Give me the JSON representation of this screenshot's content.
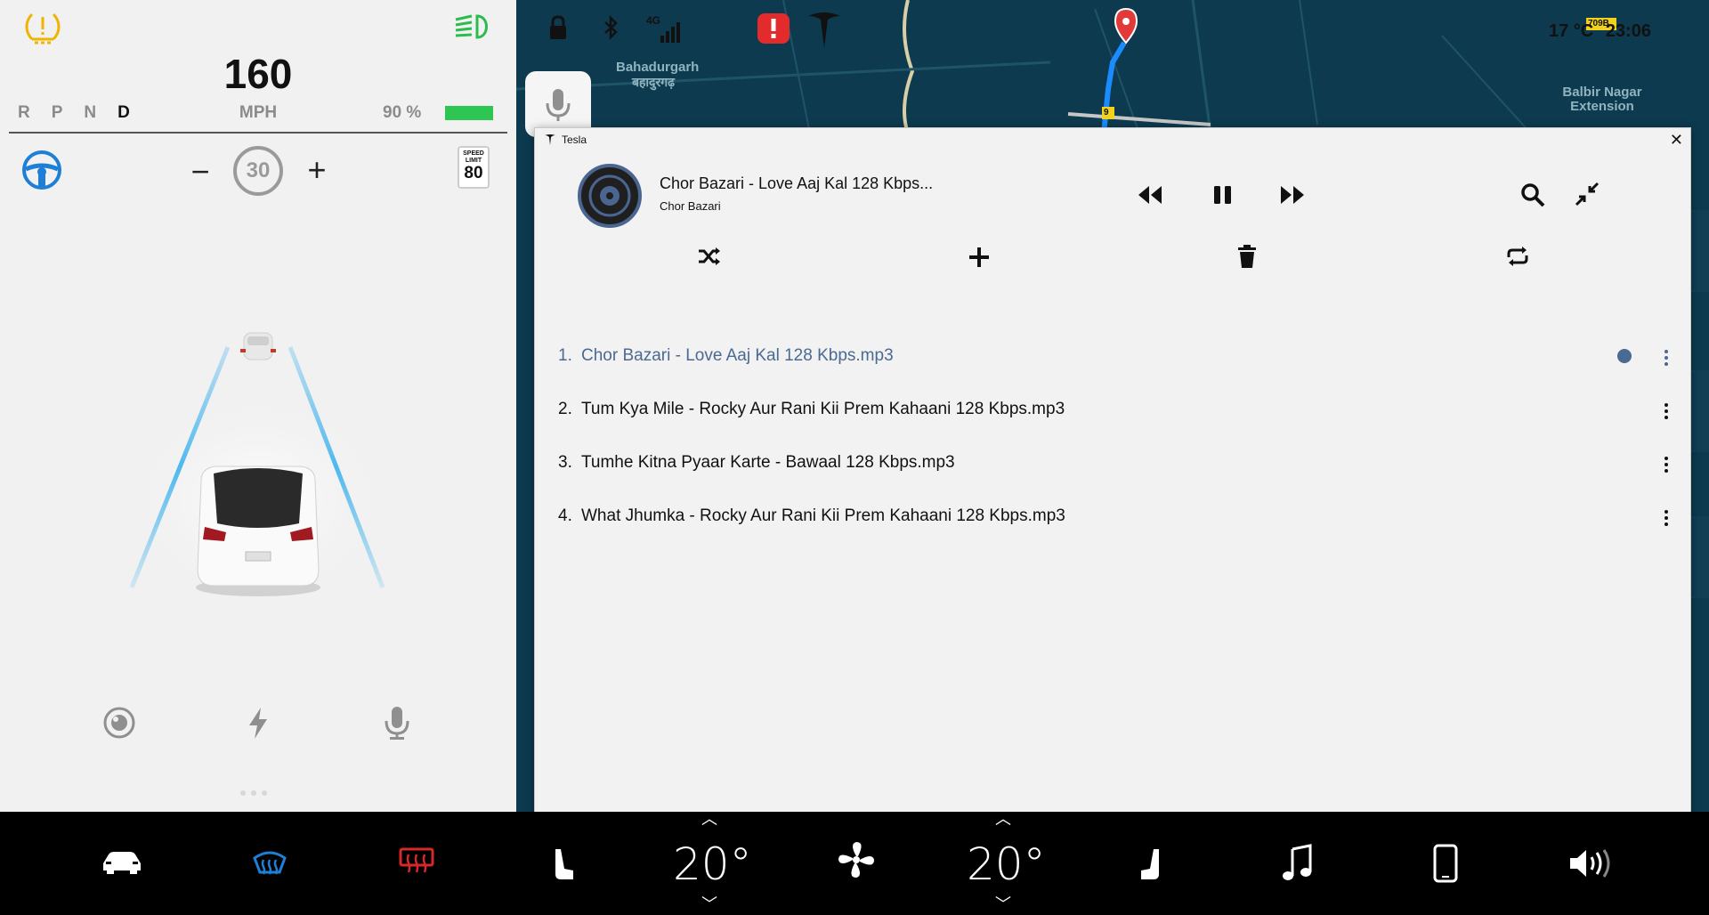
{
  "cluster": {
    "speed": "160",
    "gears": [
      "R",
      "P",
      "N",
      "D"
    ],
    "active_gear": "D",
    "unit": "MPH",
    "battery_pct": "90 %",
    "set_speed": "30",
    "minus_label": "−",
    "plus_label": "+",
    "speed_limit_title": "SPEED LIMIT",
    "speed_limit_value": "80"
  },
  "map": {
    "labels": {
      "bahadurgarh_en": "Bahadurgarh",
      "bahadurgarh_hi": "बहादुरगढ़",
      "balbir": "Balbir Nagar Extension",
      "road_badge": "9",
      "top_badge": "709B"
    },
    "status": {
      "network": "4G",
      "temperature": "17 °C",
      "time": "23:06"
    }
  },
  "window": {
    "app_title": "Tesla",
    "close_label": "✕",
    "now_playing": {
      "title": "Chor Bazari - Love Aaj Kal 128 Kbps...",
      "artist": "Chor Bazari"
    },
    "playlist": [
      {
        "num": "1.",
        "title": "Chor Bazari - Love Aaj Kal 128 Kbps.mp3",
        "current": true
      },
      {
        "num": "2.",
        "title": "Tum Kya Mile - Rocky Aur Rani Kii Prem Kahaani 128 Kbps.mp3",
        "current": false
      },
      {
        "num": "3.",
        "title": "Tumhe Kitna Pyaar Karte - Bawaal 128 Kbps.mp3",
        "current": false
      },
      {
        "num": "4.",
        "title": "What Jhumka - Rocky Aur Rani Kii Prem Kahaani 128 Kbps.mp3",
        "current": false
      }
    ]
  },
  "climate": {
    "left_temp": "20°",
    "right_temp": "20°"
  },
  "colors": {
    "accent_blue": "#1e7fd6",
    "warning_yellow": "#f0b400",
    "headlight_green": "#2dbb4e",
    "defrost_red": "#d6272b",
    "battery_green": "#2dc653",
    "current_track": "#4a6a92"
  },
  "icons": {
    "tpms": "tpms-warning-icon",
    "headlight": "headlight-icon",
    "wheel": "steering-wheel-icon",
    "lock": "lock-icon",
    "bluetooth": "bluetooth-icon",
    "signal": "signal-icon",
    "alert": "alert-icon",
    "brand": "tesla-logo-icon"
  }
}
